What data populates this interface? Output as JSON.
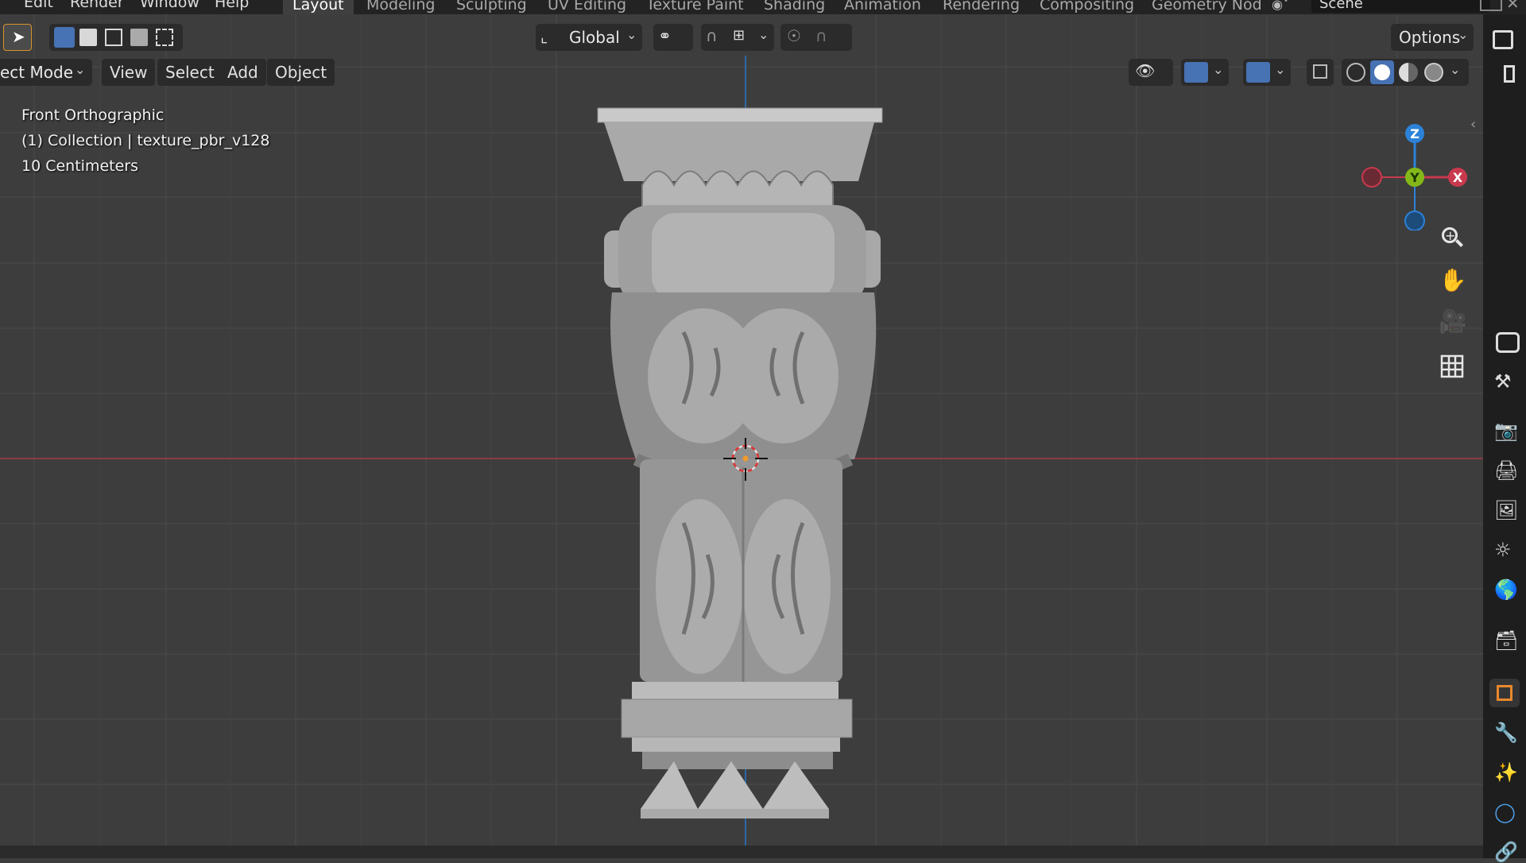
{
  "top_menu": {
    "items": [
      "Edit",
      "Render",
      "Window",
      "Help"
    ],
    "workspaces": [
      "Layout",
      "Modeling",
      "Sculpting",
      "UV Editing",
      "Texture Paint",
      "Shading",
      "Animation",
      "Rendering",
      "Compositing",
      "Geometry Nod"
    ],
    "active_workspace": "Layout",
    "scene": "Scene"
  },
  "header": {
    "transform_orientation": "Global",
    "options": "Options",
    "mode": "ect Mode",
    "menus": [
      "View",
      "Select",
      "Add",
      "Object"
    ]
  },
  "overlay": {
    "view_name": "Front Orthographic",
    "collection": "(1) Collection | texture_pbr_v128",
    "scale": "10 Centimeters"
  },
  "gizmo": {
    "z": "Z",
    "y": "Y",
    "x": "X"
  },
  "colors": {
    "x_axis": "#c9394d",
    "y_axis": "#84b81a",
    "z_axis": "#2c82d8",
    "viewport_bg": "#3d3d3d",
    "active_icon": "#4772b3",
    "accent_orange": "#e8882e"
  },
  "icons": {
    "navigation": [
      "zoom-icon",
      "pan-hand-icon",
      "camera-icon",
      "grid-view-icon"
    ],
    "properties": [
      "tool-icon",
      "render-icon",
      "output-icon",
      "view-layer-icon",
      "scene-icon",
      "world-icon",
      "collection-icon",
      "object-icon",
      "modifier-icon",
      "particles-icon",
      "physics-icon",
      "constraints-icon"
    ]
  }
}
